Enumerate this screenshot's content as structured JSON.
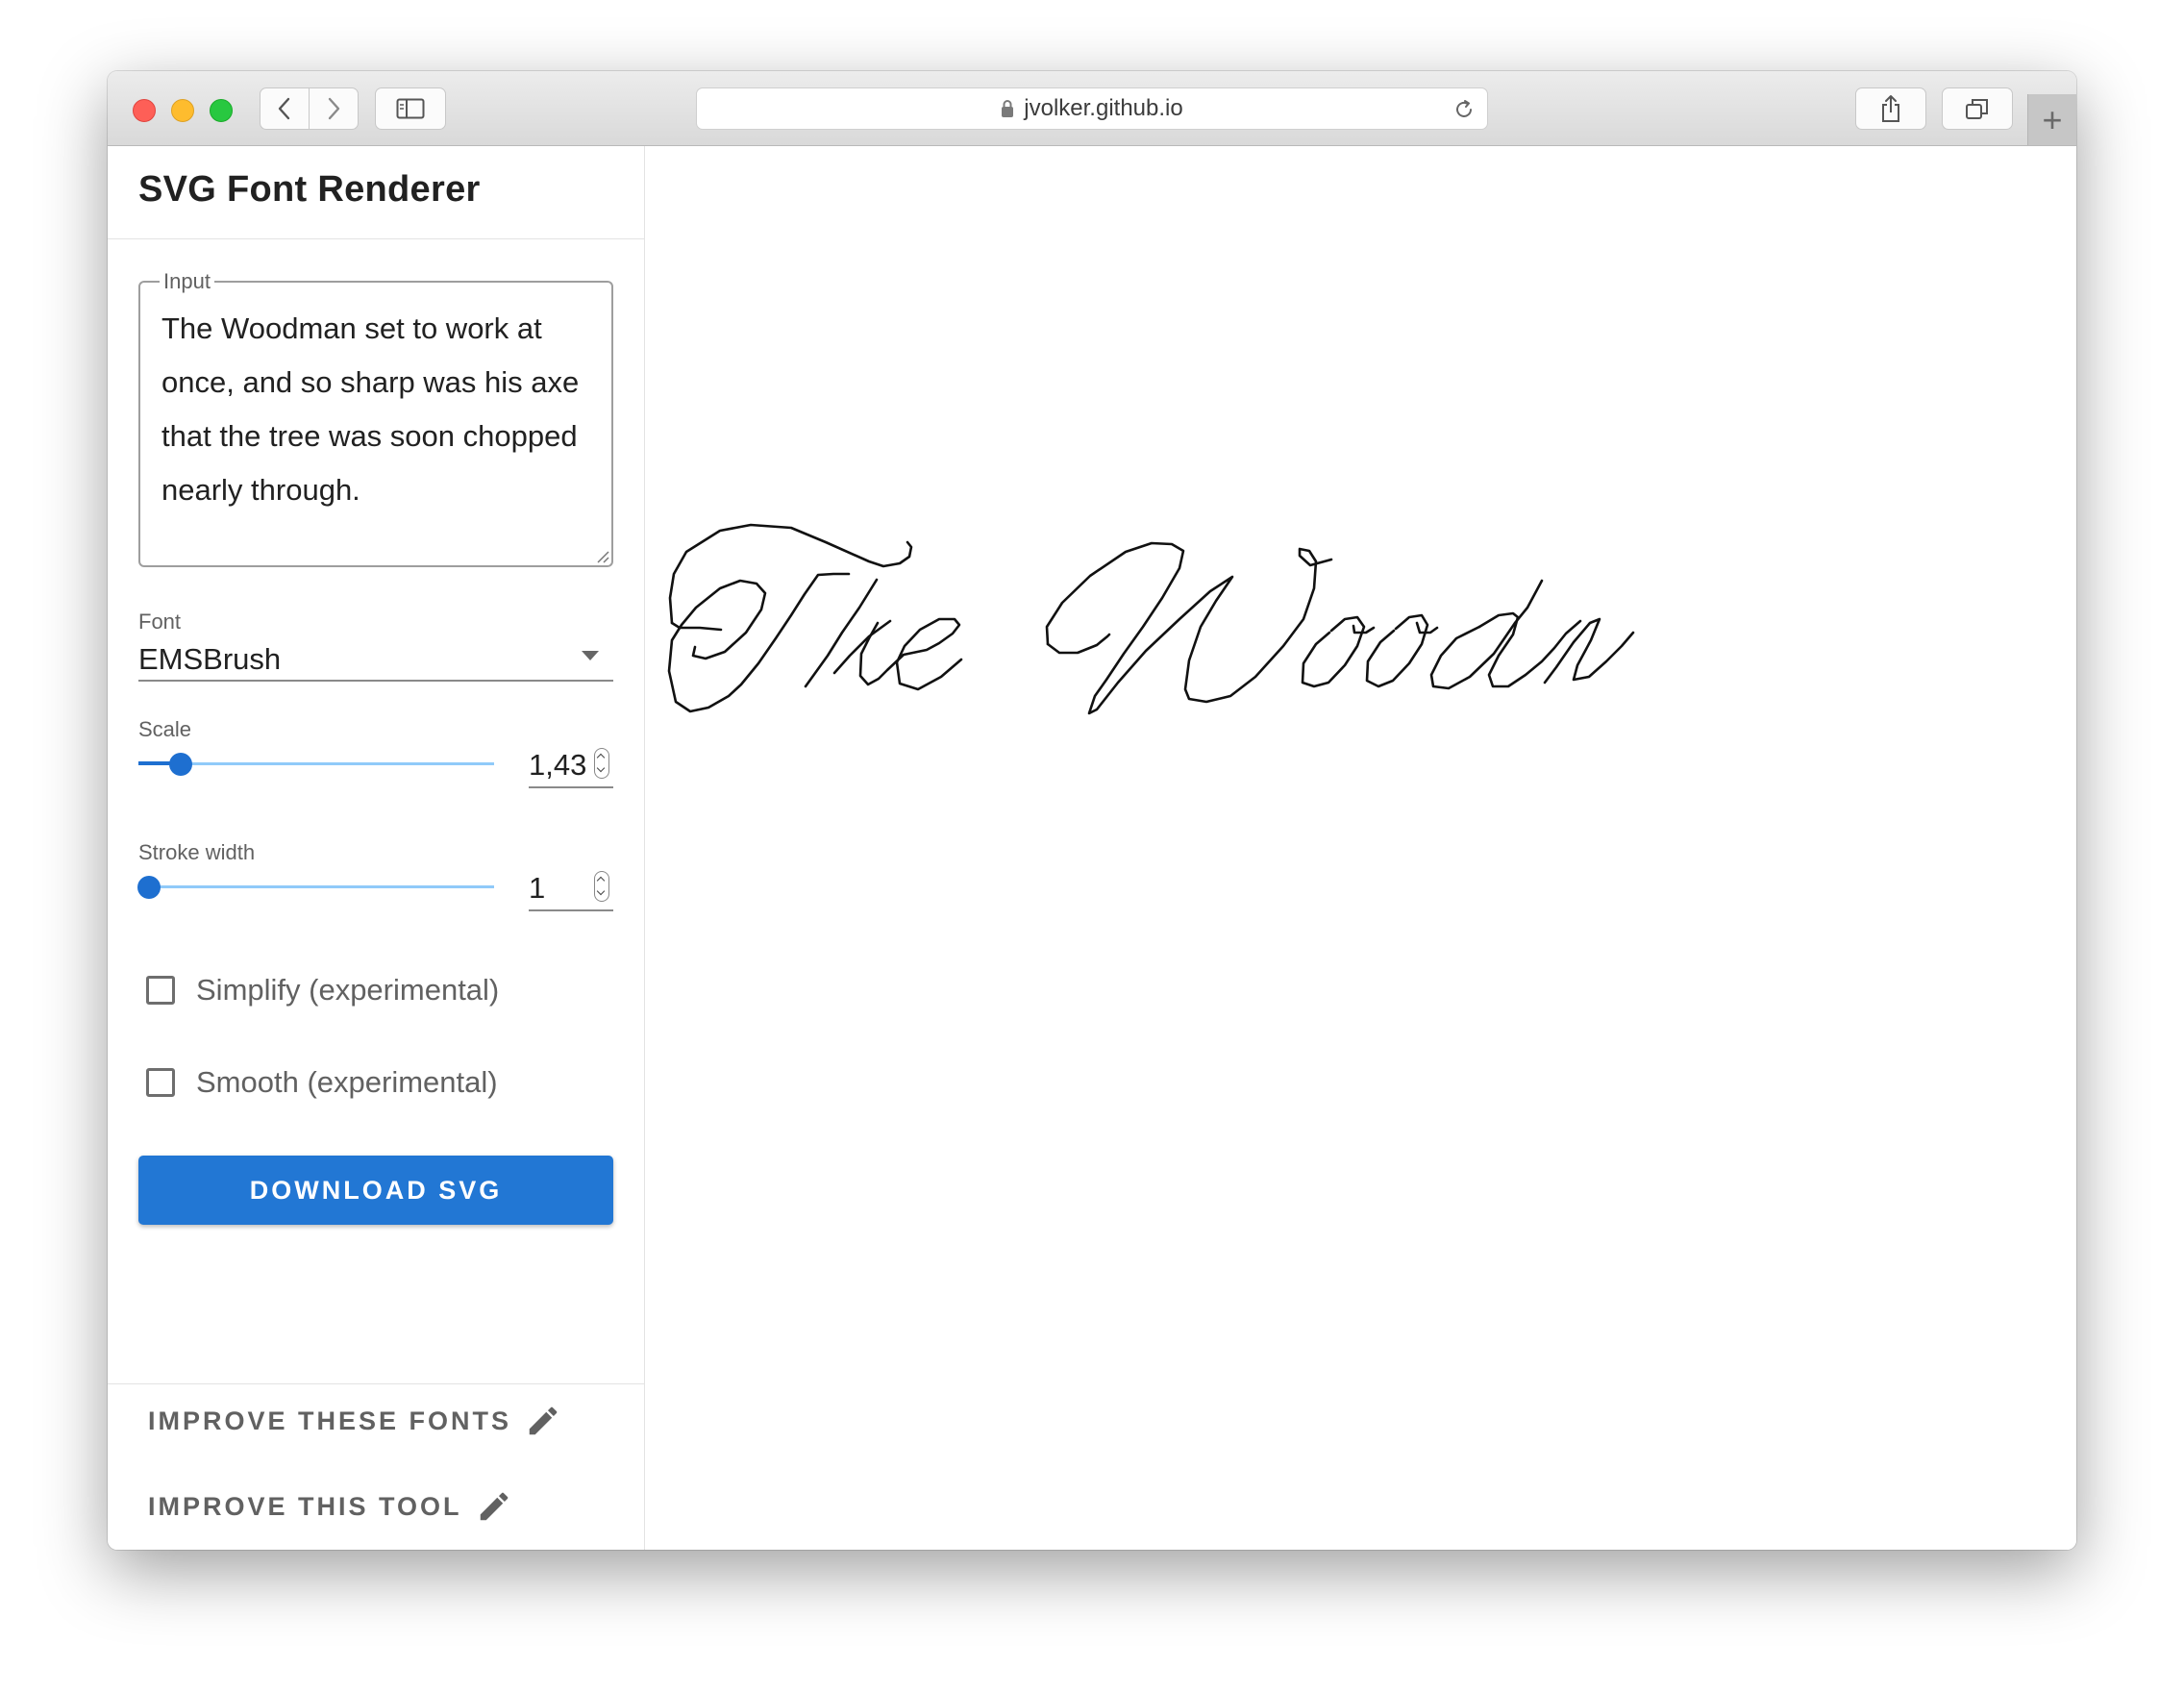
{
  "browser": {
    "url": "jvolker.github.io",
    "icons": {
      "back": "chevron-left-icon",
      "forward": "chevron-right-icon",
      "sidebar": "sidebar-icon",
      "lock": "lock-icon",
      "reload": "reload-icon",
      "share": "share-icon",
      "tabs": "tabs-icon",
      "new_tab": "plus-icon"
    },
    "new_tab_label": "+"
  },
  "sidebar": {
    "title": "SVG Font Renderer",
    "input": {
      "legend": "Input",
      "value": "The Woodman set to work at once, and so sharp was his axe that the tree was soon chopped nearly through."
    },
    "font": {
      "label": "Font",
      "value": "EMSBrush"
    },
    "scale": {
      "label": "Scale",
      "value": "1,43",
      "level": 0.12
    },
    "stroke_width": {
      "label": "Stroke width",
      "value": "1",
      "level": 0.03
    },
    "simplify": {
      "label": "Simplify (experimental)",
      "checked": false
    },
    "smooth": {
      "label": "Smooth (experimental)",
      "checked": false
    },
    "download_label": "DOWNLOAD SVG",
    "footer": {
      "improve_fonts_label": "IMPROVE THESE FONTS",
      "improve_tool_label": "IMPROVE THIS TOOL"
    }
  },
  "colors": {
    "accent": "#2277d4",
    "slider_track": "#90caf9",
    "text_primary": "#212121",
    "text_secondary": "#616161"
  }
}
